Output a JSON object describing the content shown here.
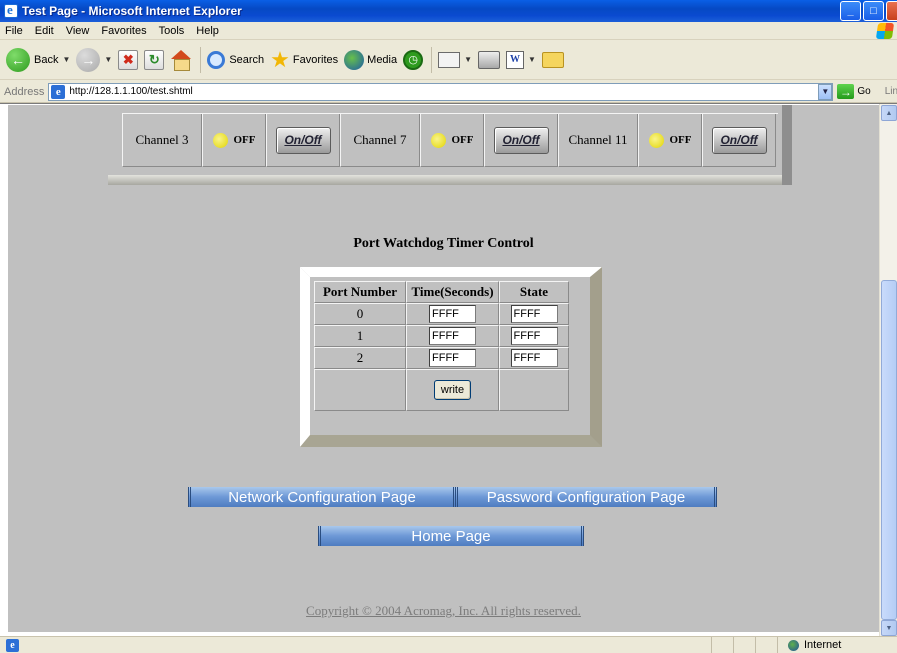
{
  "window": {
    "title": "Test Page - Microsoft Internet Explorer"
  },
  "menu": [
    "File",
    "Edit",
    "View",
    "Favorites",
    "Tools",
    "Help"
  ],
  "toolbar": {
    "back_label": "Back",
    "search_label": "Search",
    "favorites_label": "Favorites",
    "media_label": "Media"
  },
  "address": {
    "label": "Address",
    "url": "http://128.1.1.100/test.shtml",
    "go_label": "Go",
    "links_label": "Links"
  },
  "channels": [
    {
      "name": "Channel 3",
      "state": "OFF",
      "button": "On/Off"
    },
    {
      "name": "Channel 7",
      "state": "OFF",
      "button": "On/Off"
    },
    {
      "name": "Channel 11",
      "state": "OFF",
      "button": "On/Off"
    }
  ],
  "watchdog": {
    "title": "Port Watchdog Timer Control",
    "headers": [
      "Port Number",
      "Time(Seconds)",
      "State"
    ],
    "rows": [
      {
        "port": "0",
        "time": "FFFF",
        "state": "FFFF"
      },
      {
        "port": "1",
        "time": "FFFF",
        "state": "FFFF"
      },
      {
        "port": "2",
        "time": "FFFF",
        "state": "FFFF"
      }
    ],
    "write_label": "write"
  },
  "nav": {
    "network": "Network Configuration Page",
    "password": "Password Configuration Page",
    "home": "Home Page"
  },
  "copyright": "Copyright © 2004 Acromag, Inc. All rights reserved.",
  "status": {
    "zone": "Internet"
  },
  "colors": {
    "page_bg": "#c0c0c0",
    "led": "#e8dc1a",
    "nav_button": "#6d98d6"
  }
}
